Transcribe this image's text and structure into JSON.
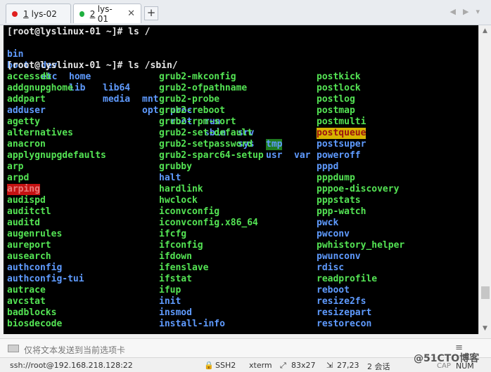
{
  "tabs": [
    {
      "index": "1",
      "label": "lys-02",
      "dot_color": "#e02020",
      "active": false
    },
    {
      "index": "2",
      "label": "lys-01",
      "dot_color": "#20b040",
      "active": true
    }
  ],
  "tab_add_label": "+",
  "terminal": {
    "prompt1": "[root@lyslinux-01 ~]# ls /",
    "root_dirs": [
      [
        "bin",
        "dev",
        "home",
        "lib64",
        "mnt",
        "proc",
        "run",
        "srv",
        "tmp",
        "var"
      ],
      [
        "boot",
        "etc",
        "lib",
        "media",
        "opt",
        "root",
        "sbin",
        "sys",
        "usr"
      ]
    ],
    "prompt2": "[root@lyslinux-01 ~]# ls /sbin/",
    "sbin_col1": [
      "accessdb",
      "addgnupghome",
      "addpart",
      "adduser",
      "agetty",
      "alternatives",
      "anacron",
      "applygnupgdefaults",
      "arp",
      "arpd",
      "arping",
      "audispd",
      "auditctl",
      "auditd",
      "augenrules",
      "aureport",
      "ausearch",
      "authconfig",
      "authconfig-tui",
      "autrace",
      "avcstat",
      "badblocks",
      "biosdecode"
    ],
    "sbin_col2": [
      "grub2-mkconfig",
      "grub2-ofpathname",
      "grub2-probe",
      "grub2-reboot",
      "grub2-rpm-sort",
      "grub2-set-default",
      "grub2-setpassword",
      "grub2-sparc64-setup",
      "grubby",
      "halt",
      "hardlink",
      "hwclock",
      "iconvconfig",
      "iconvconfig.x86_64",
      "ifcfg",
      "ifconfig",
      "ifdown",
      "ifenslave",
      "ifstat",
      "ifup",
      "init",
      "insmod",
      "install-info"
    ],
    "sbin_col3": [
      "postkick",
      "postlock",
      "postlog",
      "postmap",
      "postmulti",
      "postqueue",
      "postsuper",
      "poweroff",
      "pppd",
      "pppdump",
      "pppoe-discovery",
      "pppstats",
      "ppp-watch",
      "pwck",
      "pwconv",
      "pwhistory_helper",
      "pwunconv",
      "rdisc",
      "readprofile",
      "reboot",
      "resize2fs",
      "resizepart",
      "restorecon"
    ]
  },
  "sendbar": {
    "placeholder": "仅将文本发送到当前选项卡"
  },
  "status": {
    "connection": "ssh://root@192.168.218.128:22",
    "protocol": "SSH2",
    "terminal": "xterm",
    "size": "83x27",
    "position": "27,23",
    "sessions": "2 会话",
    "cap": "CAP",
    "num": "NUM"
  },
  "watermark": "@51CTO博客"
}
